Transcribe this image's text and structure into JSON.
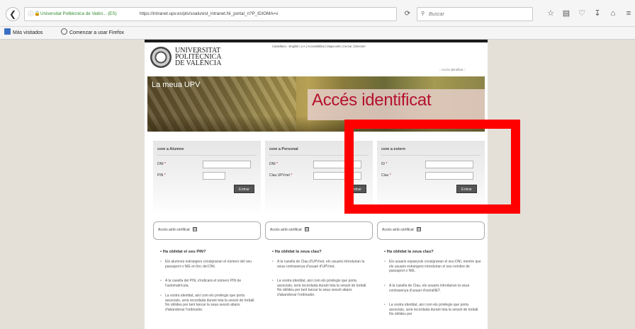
{
  "browser": {
    "site_identity": "Universitat Politècnica de Valèn... (ES)",
    "url": "https://intranet.upv.es/pls/soalu/est_intranet.Ni_portal_n?P_IDIOMA=v",
    "search_placeholder": "Buscar",
    "bookmarks": [
      {
        "label": "Más visitados",
        "icon": "bookmark-folder-icon",
        "color": "#3a6fc2"
      },
      {
        "label": "Comenzar a usar Firefox",
        "icon": "firefox-icon",
        "color": "#555555"
      }
    ],
    "toolbar_icons": [
      "star-icon",
      "reading-list-icon",
      "pocket-icon",
      "download-icon",
      "home-icon",
      "menu-icon"
    ]
  },
  "header": {
    "university_line1": "UNIVERSITAT",
    "university_line2": "POLITÈCNICA",
    "university_line3": "DE VALÈNCIA",
    "langbar": "Castellano · English  |  a  A  |  Accessibilitat  |  Mapa web  |  Cercar  |  Directori",
    "acces_link": "::  Accés identificat  ::"
  },
  "banner": {
    "small_title": "La meua UPV",
    "title": "Accés identificat"
  },
  "login_boxes": [
    {
      "title": "com a Alumne",
      "field1_label": "DNI",
      "field2_label": "PIN",
      "required_mark": "*",
      "button": "Entrar"
    },
    {
      "title": "com a Personal",
      "field1_label": "DNI",
      "field2_label": "Clau UPVnet",
      "required_mark": "*",
      "button": "Entrar"
    },
    {
      "title": "com a extern",
      "field1_label": "ID",
      "field2_label": "Clau",
      "required_mark": "*",
      "button": "Entrar"
    }
  ],
  "certificate_label": "Accés amb certificat",
  "help_columns": [
    {
      "title": "Ha oblidat el seu PIN?",
      "items": [
        "Els alumnes estrangers consignaran el número del seu passaport o NIE en lloc del DNI.",
        "A la casella del PIN, s'indicarà el número PIN de l'automatrícula.",
        "La vostra identitat, així com els privilegis que porta associats, serà recordada durant tota la sessió de treball. No oblideu per tant tancar la seua sessió abans d'abandonar l'ordinador."
      ]
    },
    {
      "title": "Ha oblidat la seua clau?",
      "items": [
        "A la casella de Clau d'UPVnet, els usuaris introduiran la seua contrasenya d'usuari d'UPVnet.",
        "La vostra identitat, així com els privilegis que porta associats, serà recordada durant tota la sessió de treball. No oblideu per tant tancar la seua sessió abans d'abandonar l'ordinador."
      ]
    },
    {
      "title": "Ha oblidat la seua clau?",
      "items": [
        "Els usuaris espanyols consignaran el seu DNI, mentre que els usuaris estrangers introduiran el seu nombre de passaport o NIE.",
        "A la casella de Clau, els usuaris introduiran la seua contrasenya d'usuari d'extraNET.",
        "La vostra identitat, així com els privilegis que porta associats, serà recordada durant tota la sessió de treball. No oblideu per"
      ]
    }
  ],
  "colors": {
    "highlight": "#ff0000",
    "banner_title": "#b5122d",
    "required": "#c0102a"
  }
}
